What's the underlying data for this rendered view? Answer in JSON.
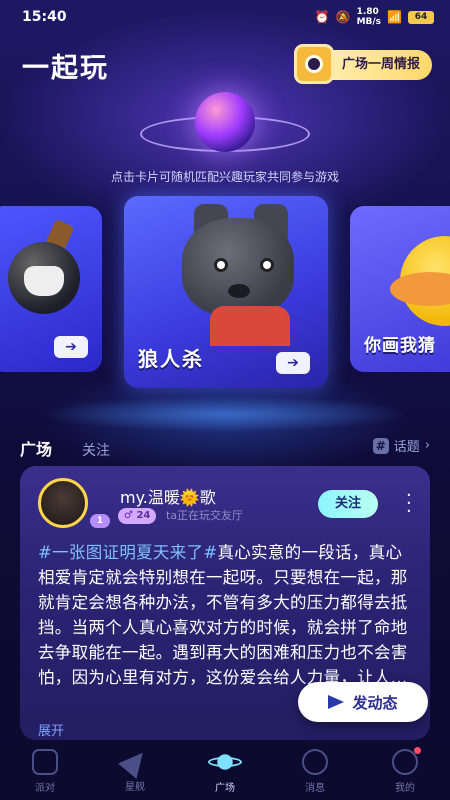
{
  "status_bar": {
    "time": "15:40",
    "net_speed": "1.80",
    "net_unit": "MB/s",
    "battery": "64"
  },
  "header": {
    "title": "一起玩",
    "weekly_button": "广场一周情报"
  },
  "tagline": "点击卡片可随机匹配兴趣玩家共同参与游戏",
  "cards": [
    {
      "label": "",
      "arrow": "➔"
    },
    {
      "label": "狼人杀",
      "arrow": "➔"
    },
    {
      "label": "你画我猜",
      "arrow": ""
    }
  ],
  "feed_tabs": {
    "active": "广场",
    "other": "关注",
    "topic": "话题"
  },
  "post": {
    "level": "1",
    "username_a": "my.温暖",
    "username_sun": "🌞",
    "username_b": "歌",
    "badge": "♂ 24",
    "playing": "ta正在玩交友厅",
    "follow_label": "关注",
    "hashtag": "#一张图证明夏天来了#",
    "text": "真心实意的一段话，真心相爱肯定就会特别想在一起呀。只要想在一起，那就肯定会想各种办法，不管有多大的压力都得去抵挡。当两个人真心喜欢对方的时候，就会拼了命地去争取能在一起。遇到再大的困难和压力也不会害怕，因为心里有对方，这份爱会给人力量，让人...",
    "expand": "展开"
  },
  "fab_label": "发动态",
  "nav": [
    {
      "label": "派对"
    },
    {
      "label": "星舰"
    },
    {
      "label": "广场"
    },
    {
      "label": "消息"
    },
    {
      "label": "我的"
    }
  ]
}
